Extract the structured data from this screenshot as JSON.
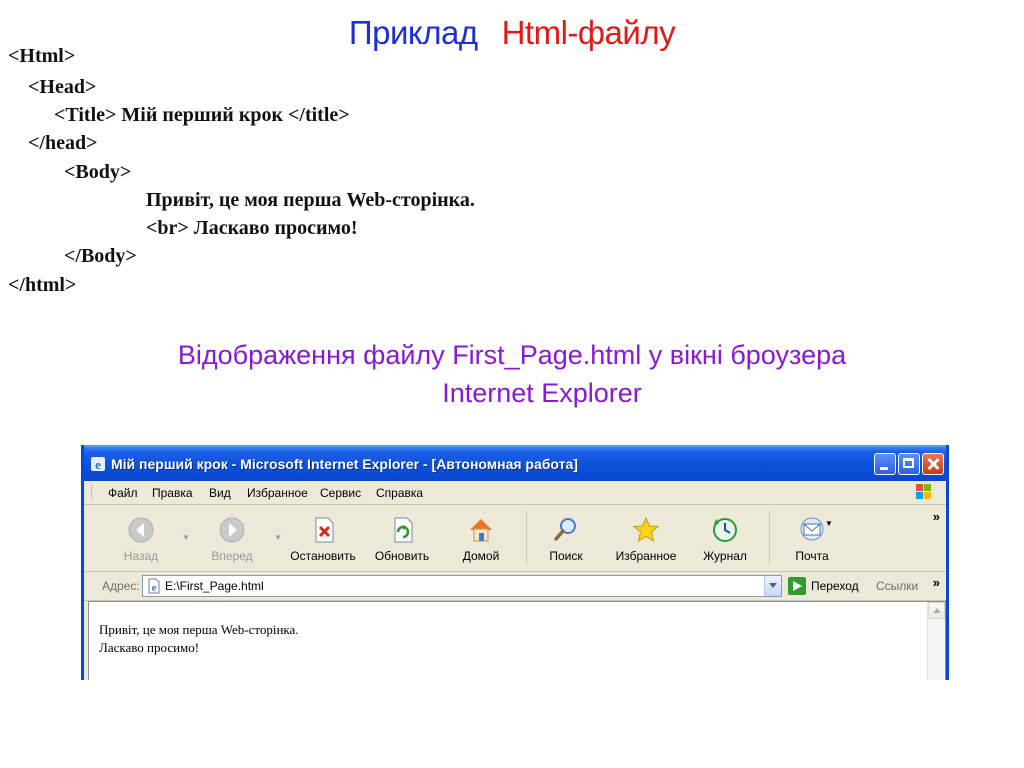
{
  "slide": {
    "title_part1": "Приклад",
    "title_part2": "Html-файлу",
    "code_lines": [
      "<Html>",
      "<Head>",
      "<Title> Мій перший крок </title>",
      "</head>",
      "<Body>",
      "Привіт, це моя перша Web-сторінка.",
      "<br>  Ласкаво просимо!",
      "</Body>",
      "</html>"
    ],
    "caption_line1": "Відображення файлу First_Page.html у вікні броузера",
    "caption_line2": "Internet Explorer"
  },
  "window": {
    "title": "Мій перший крок - Microsoft Internet Explorer - [Автономная работа]",
    "icons": {
      "app": "ie-logo-icon",
      "minimize": "minimize-icon",
      "maximize": "maximize-icon",
      "close": "close-icon"
    },
    "menu": [
      "Файл",
      "Правка",
      "Вид",
      "Избранное",
      "Сервис",
      "Справка"
    ],
    "toolbar": {
      "back": "Назад",
      "forward": "Вперед",
      "stop": "Остановить",
      "refresh": "Обновить",
      "home": "Домой",
      "search": "Поиск",
      "favorites": "Избранное",
      "history": "Журнал",
      "mail": "Почта",
      "more": "»"
    },
    "address": {
      "label": "Адрес:",
      "value": "E:\\First_Page.html",
      "go_label": "Переход",
      "links_label": "Ссылки",
      "more": "»"
    },
    "content_lines": [
      "Привіт, це моя перша Web-сторінка.",
      "Ласкаво просимо!"
    ]
  },
  "colors": {
    "title_blue": "#1f2fd6",
    "title_red": "#e01919",
    "caption_purple": "#8a18d6",
    "xp_titlebar": "#0b50d9",
    "xp_chrome": "#ece9d8"
  }
}
